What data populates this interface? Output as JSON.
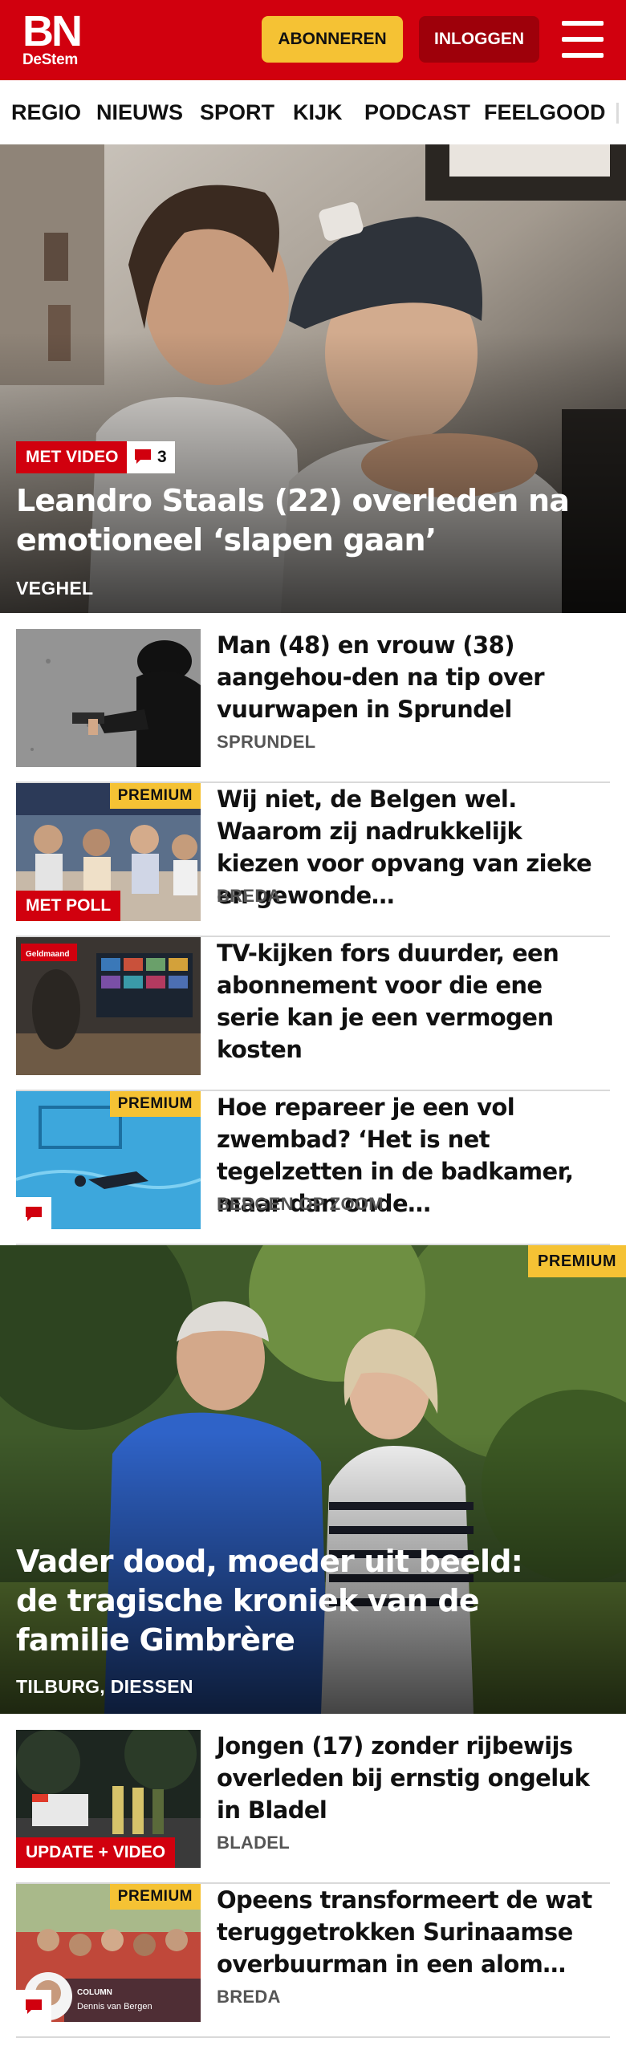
{
  "header": {
    "logo_main": "BN",
    "logo_sub": "DeStem",
    "subscribe_label": "ABONNEREN",
    "login_label": "INLOGGEN"
  },
  "nav": {
    "items": [
      "REGIO",
      "NIEUWS",
      "SPORT",
      "KIJK",
      "PODCAST",
      "FEELGOOD"
    ]
  },
  "hero1": {
    "tag": "MET VIDEO",
    "comment_count": "3",
    "title": "Leandro Staals (22) overleden na emotioneel ‘slapen gaan’",
    "location": "VEGHEL"
  },
  "articles": [
    {
      "title": "Man (48) en vrouw (38) aangehou-den na tip over vuurwapen in Sprundel",
      "location": "SPRUNDEL"
    },
    {
      "premium": "PREMIUM",
      "tag": "MET POLL",
      "title": "Wij niet, de Belgen wel. Waarom zij nadrukkelijk kiezen voor opvang van zieke en gewonde…",
      "location": "BREDA"
    },
    {
      "title": "TV-kijken fors duurder, een abonnement voor die ene serie kan je een vermogen kosten",
      "thumb_label": "Geldmaand"
    },
    {
      "premium": "PREMIUM",
      "title": "Hoe repareer je een vol zwembad? ‘Het is net tegelzetten in de badkamer, maar dan onde…",
      "location": "BERGEN OP ZOOM"
    }
  ],
  "hero2": {
    "premium": "PREMIUM",
    "title": "Vader dood, moeder uit beeld: de tragische kroniek van de familie Gimbrère",
    "location": "TILBURG, DIESSEN"
  },
  "articles2": [
    {
      "tag": "UPDATE + VIDEO",
      "title": "Jongen (17) zonder rijbewijs overleden bij ernstig ongeluk in Bladel",
      "location": "BLADEL"
    },
    {
      "premium": "PREMIUM",
      "column_label": "COLUMN",
      "column_author": "Dennis van Bergen",
      "title": "Opeens transformeert de wat teruggetrokken Surinaamse overbuurman in een alom…",
      "location": "BREDA"
    }
  ],
  "colors": {
    "brand_red": "#d1000e",
    "premium_yellow": "#f5c234",
    "login_dark_red": "#9e000a"
  }
}
